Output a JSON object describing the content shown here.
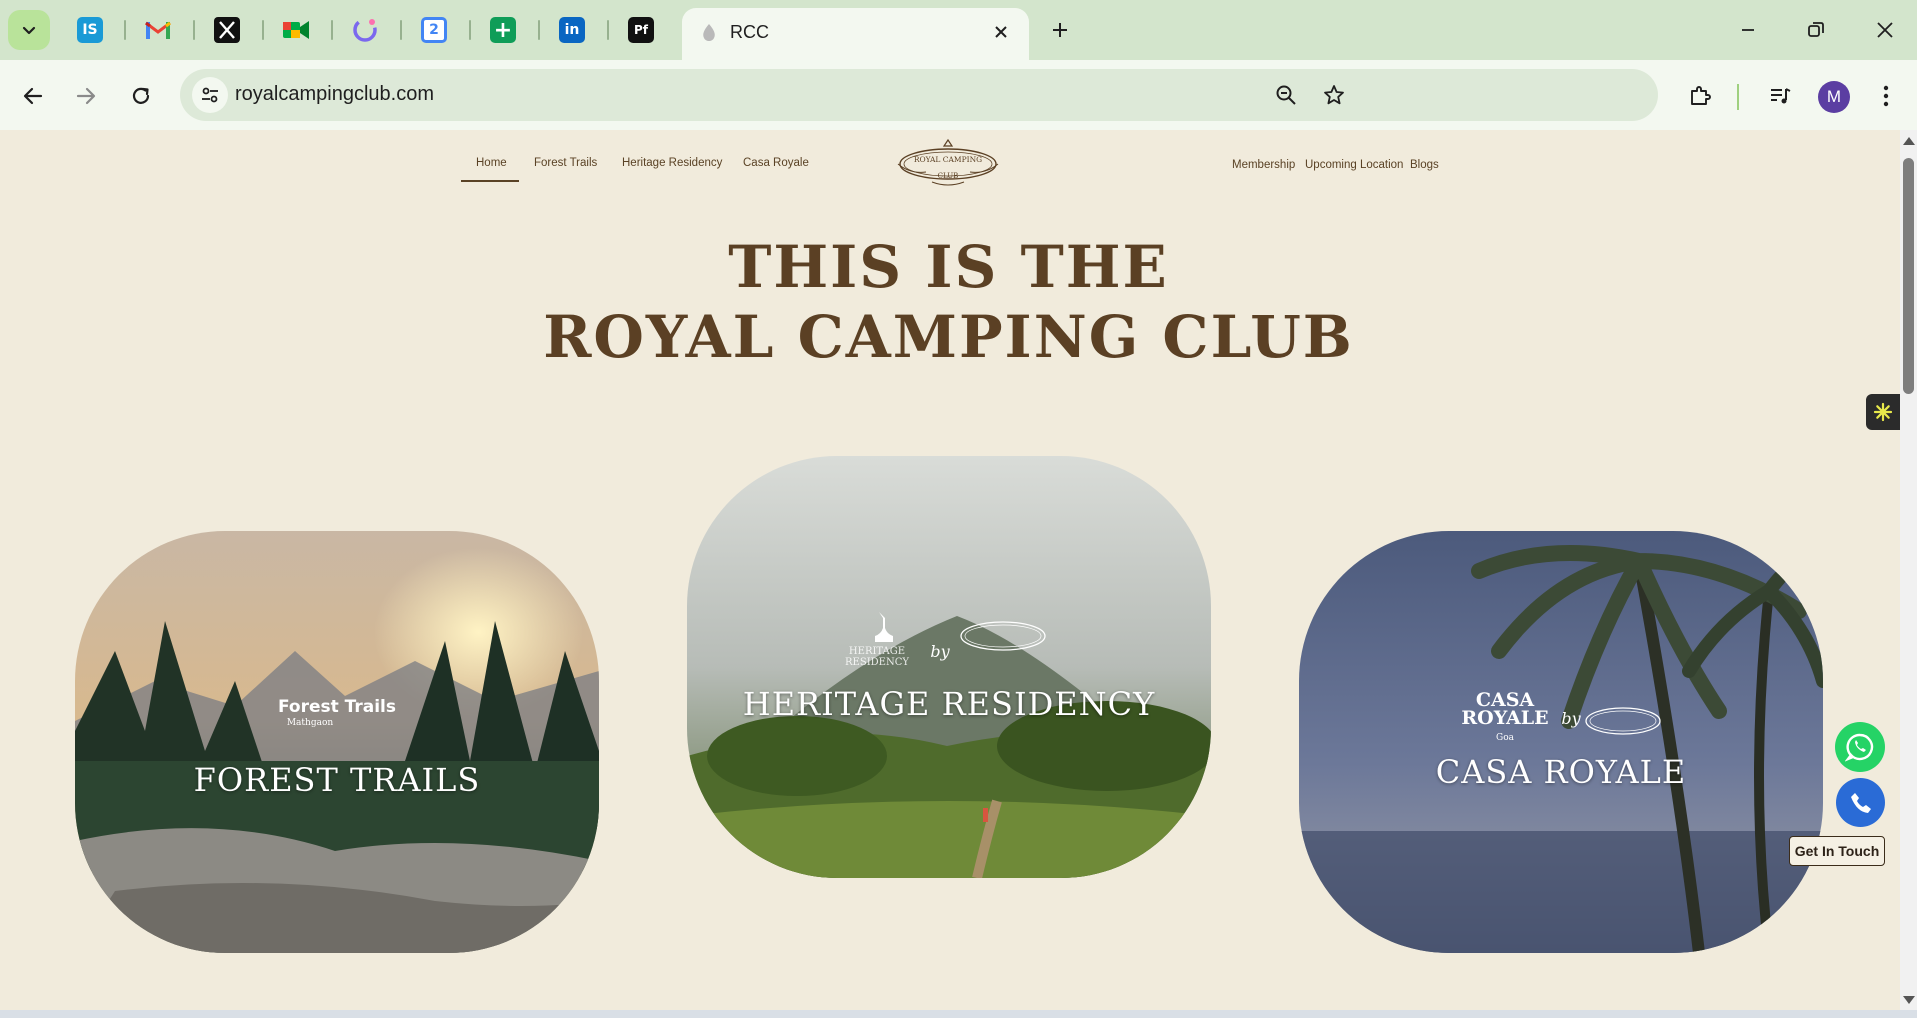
{
  "browser": {
    "active_tab_title": "RCC",
    "pinned_tabs": [
      {
        "icon": "is-icon",
        "letter": "IS",
        "color": "#1a9ad6"
      },
      {
        "icon": "gmail-icon",
        "letter": "M",
        "color": "#ea4335"
      },
      {
        "icon": "x-icon",
        "letter": "X",
        "color": "#111111"
      },
      {
        "icon": "google-meet-icon",
        "letter": "",
        "color": "#00ac47"
      },
      {
        "icon": "clickup-icon",
        "letter": "",
        "color": "#7b68ee"
      },
      {
        "icon": "google-calendar-icon",
        "letter": "2",
        "color": "#4285f4"
      },
      {
        "icon": "google-sheets-icon",
        "letter": "+",
        "color": "#0f9d58"
      },
      {
        "icon": "linkedin-icon",
        "letter": "in",
        "color": "#0a66c2"
      },
      {
        "icon": "pf-icon",
        "letter": "Pf",
        "color": "#111111"
      }
    ],
    "url": "royalcampingclub.com",
    "profile_initial": "M"
  },
  "site": {
    "nav_left": [
      "Home",
      "Forest Trails",
      "Heritage Residency",
      "Casa Royale"
    ],
    "nav_right": [
      "Membership",
      "Upcoming Location",
      "Blogs"
    ],
    "logo_text_top": "ROYAL CAMPING",
    "logo_text_bottom": "CLUB",
    "hero_line1": "THIS IS THE",
    "hero_line2": "ROYAL CAMPING CLUB",
    "cards": [
      {
        "title": "FOREST TRAILS",
        "sub_brand": "Forest Trails",
        "sub_place": "Mathgaon"
      },
      {
        "title": "HERITAGE RESIDENCY",
        "sub_brand": "HERITAGE RESIDENCY",
        "sub_place": ""
      },
      {
        "title": "CASA ROYALE",
        "sub_brand": "CASA ROYALE",
        "sub_place": "Goa"
      }
    ],
    "by_text": "by",
    "get_in_touch": "Get In Touch"
  },
  "colors": {
    "page_bg": "#f1ebdc",
    "heading": "#5b4024",
    "tabbar": "#d3e5cc",
    "toolbar": "#f3f8f0"
  }
}
